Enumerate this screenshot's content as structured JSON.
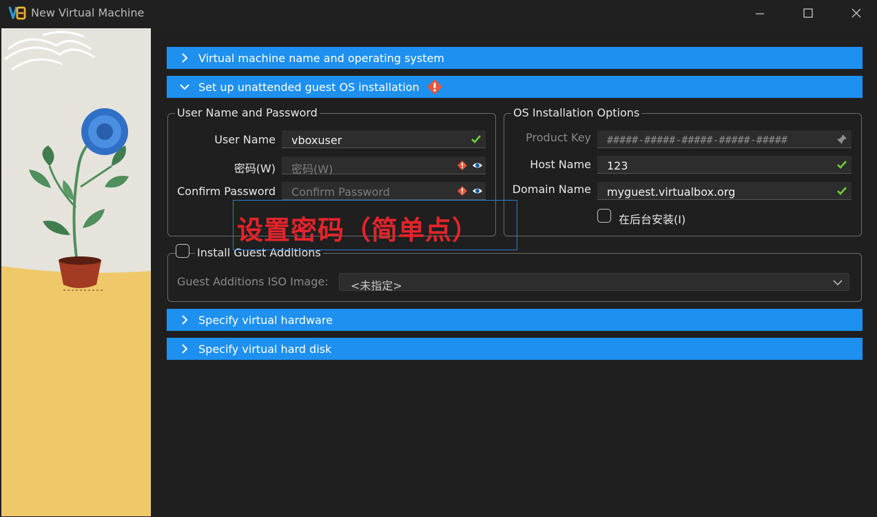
{
  "window": {
    "title": "New Virtual Machine",
    "icons": {
      "app": "virtualbox-icon",
      "minimize": "minimize-icon",
      "maximize": "maximize-icon",
      "close": "close-icon"
    }
  },
  "sections": {
    "name_os": {
      "label": "Virtual machine name and operating system",
      "expanded": false
    },
    "unattended": {
      "label": "Set up unattended guest OS installation",
      "expanded": true,
      "warning_icon": "warning-icon"
    },
    "hardware": {
      "label": "Specify virtual hardware",
      "expanded": false
    },
    "hard_disk": {
      "label": "Specify virtual hard disk",
      "expanded": false
    }
  },
  "user_group": {
    "title": "User Name and Password",
    "username_label": "User Name",
    "username_value": "vboxuser",
    "password_label": "密码(W)",
    "password_placeholder": "密码(W)",
    "confirm_label": "Confirm Password",
    "confirm_placeholder": "Confirm Password"
  },
  "os_group": {
    "title": "OS Installation Options",
    "product_key_label": "Product Key",
    "product_key_value": "#####-#####-#####-#####-#####",
    "host_name_label": "Host Name",
    "host_name_value": "123",
    "domain_label": "Domain Name",
    "domain_value": "myguest.virtualbox.org",
    "background_label": "在后台安装(I)",
    "background_checked": false
  },
  "guest_additions": {
    "label": "Install Guest Additions",
    "checked": false,
    "iso_label": "Guest Additions ISO Image:",
    "iso_value": "<未指定>"
  },
  "annotation": {
    "text": "设置密码（简单点）"
  },
  "colors": {
    "accent": "#1e90f0",
    "warning": "#e8553a",
    "valid": "#6fd13c",
    "annotation": "#e4242b"
  }
}
